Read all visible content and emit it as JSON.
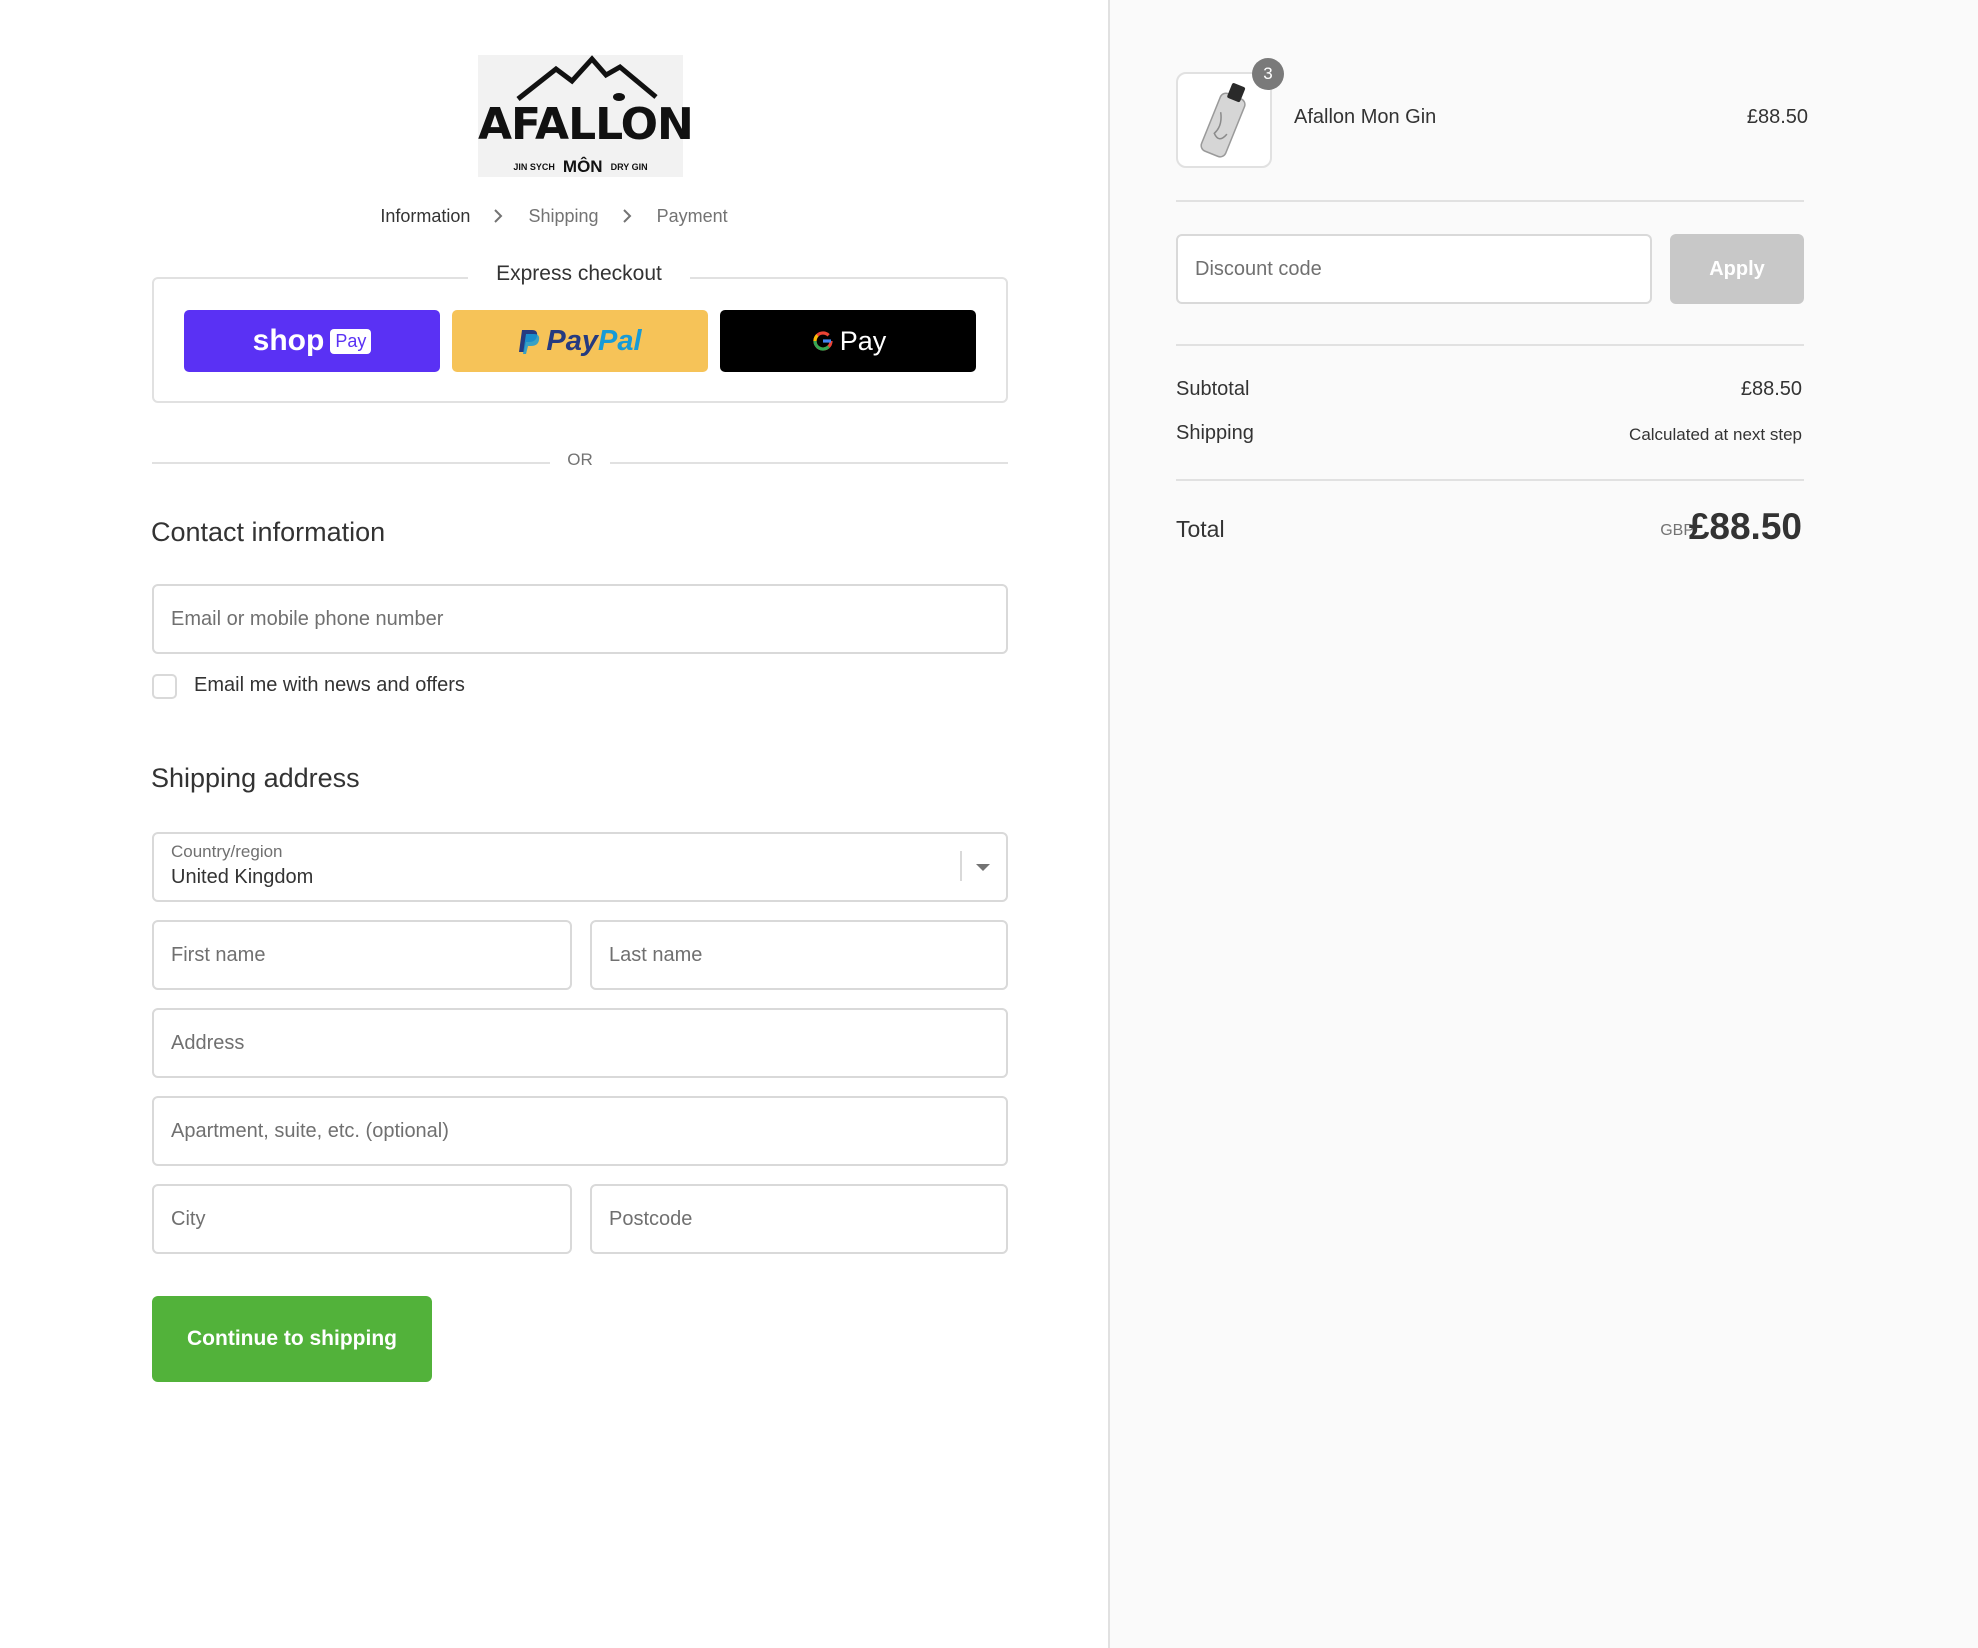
{
  "logo": {
    "word": "AFALLON",
    "sub_left": "JIN SYCH",
    "sub_mid": "MÔN",
    "sub_right": "DRY GIN"
  },
  "breadcrumb": {
    "step1": "Information",
    "step2": "Shipping",
    "step3": "Payment"
  },
  "express": {
    "title": "Express checkout",
    "shop_pay": "shop",
    "shop_pay_pill": "Pay",
    "paypal_a": "Pay",
    "paypal_b": "Pal",
    "gpay": "Pay"
  },
  "or_text": "OR",
  "contact": {
    "heading": "Contact information",
    "email_placeholder": "Email or mobile phone number",
    "newsletter_label": "Email me with news and offers"
  },
  "shipping": {
    "heading": "Shipping address",
    "country_label": "Country/region",
    "country_value": "United Kingdom",
    "first_name": "First name",
    "last_name": "Last name",
    "address": "Address",
    "apartment": "Apartment, suite, etc. (optional)",
    "city": "City",
    "postcode": "Postcode"
  },
  "continue_label": "Continue to shipping",
  "summary": {
    "product_name": "Afallon Mon Gin",
    "quantity": "3",
    "product_price": "£88.50",
    "discount_placeholder": "Discount code",
    "apply_label": "Apply",
    "subtotal_label": "Subtotal",
    "subtotal_value": "£88.50",
    "shipping_label": "Shipping",
    "shipping_value": "Calculated at next step",
    "total_label": "Total",
    "currency": "GBP",
    "total_value": "£88.50"
  },
  "colors": {
    "accent_green": "#52b23a",
    "shop_pay": "#5a31f4",
    "paypal_yellow": "#f6c358"
  }
}
